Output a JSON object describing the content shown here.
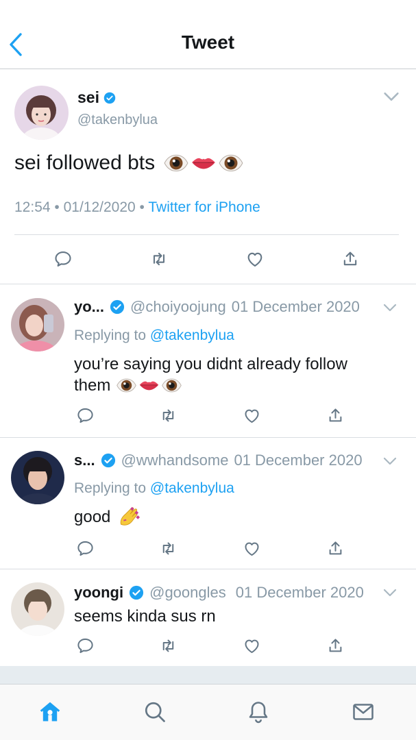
{
  "header": {
    "title": "Tweet"
  },
  "main_tweet": {
    "name": "sei",
    "handle": "@takenbylua",
    "text": "sei followed bts",
    "time": "12:54",
    "date": "01/12/2020",
    "source": "Twitter for iPhone",
    "emojis": [
      "eye-emoji",
      "lips-emoji",
      "eye-emoji"
    ]
  },
  "replies": [
    {
      "name": "yo...",
      "handle": "@choiyoojung",
      "date": "01 December 2020",
      "replying_prefix": "Replying to",
      "replying_to": "@takenbylua",
      "text_line1": "you’re saying you didnt already follow",
      "text_line2": "them"
    },
    {
      "name": "s...",
      "handle": "@wwhandsome",
      "date": "01 December 2020",
      "replying_prefix": "Replying to",
      "replying_to": "@takenbylua",
      "text": "good"
    },
    {
      "name": "yoongi",
      "handle": "@goongles",
      "date": "01 December 2020",
      "text": "seems kinda sus rn"
    }
  ],
  "tabbar": {
    "items": [
      "home-icon",
      "search-icon",
      "bell-icon",
      "mail-icon"
    ],
    "active": "home-icon"
  },
  "colors": {
    "accent": "#1da1f2",
    "secondary_text": "#8899a6",
    "primary_text": "#14171a",
    "verified": "#1da1f2"
  }
}
